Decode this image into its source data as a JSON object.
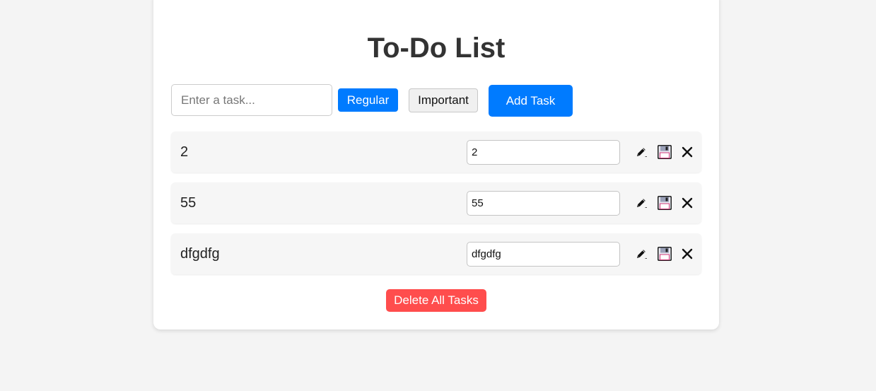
{
  "app": {
    "title": "To-Do List"
  },
  "form": {
    "input_placeholder": "Enter a task...",
    "input_value": "",
    "priority_buttons": [
      {
        "label": "Regular",
        "selected": true
      },
      {
        "label": "Important",
        "selected": false
      }
    ],
    "add_label": "Add Task"
  },
  "tasks": [
    {
      "text": "2",
      "edit_value": "2"
    },
    {
      "text": "55",
      "edit_value": "55"
    },
    {
      "text": "dfgdfg",
      "edit_value": "dfgdfg"
    }
  ],
  "task_actions": {
    "edit_icon": "pencil-icon",
    "save_icon": "floppy-disk-icon",
    "delete_icon": "close-icon"
  },
  "footer": {
    "delete_all_label": "Delete All Tasks"
  },
  "colors": {
    "primary": "#007bff",
    "danger": "#ff4d4d",
    "background": "#f4f4f4",
    "card": "#ffffff",
    "row": "#f6f6f6",
    "title": "#333333"
  }
}
